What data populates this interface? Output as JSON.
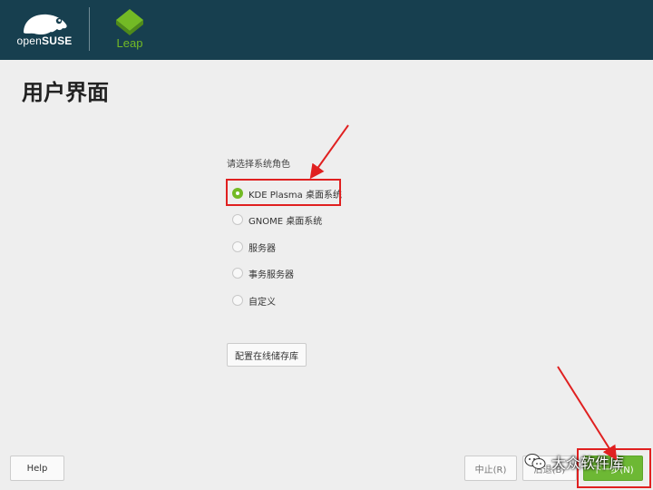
{
  "header": {
    "brand_prefix": "open",
    "brand_suffix": "SUSE",
    "product": "Leap",
    "background_color": "#173f4f",
    "accent_color": "#73ba25"
  },
  "page": {
    "title": "用户界面",
    "prompt": "请选择系统角色"
  },
  "roles": [
    {
      "label": "KDE Plasma 桌面系统",
      "checked": true
    },
    {
      "label": "GNOME 桌面系统",
      "checked": false
    },
    {
      "label": "服务器",
      "checked": false
    },
    {
      "label": "事务服务器",
      "checked": false
    },
    {
      "label": "自定义",
      "checked": false
    }
  ],
  "buttons": {
    "configure_repos": "配置在线储存库",
    "help": "Help",
    "abort": "中止(R)",
    "back": "后退(B)",
    "next": "下一步(N)"
  },
  "watermark": {
    "text": "大众软件库",
    "icon": "wechat-icon"
  },
  "annotation_color": "#e02020"
}
